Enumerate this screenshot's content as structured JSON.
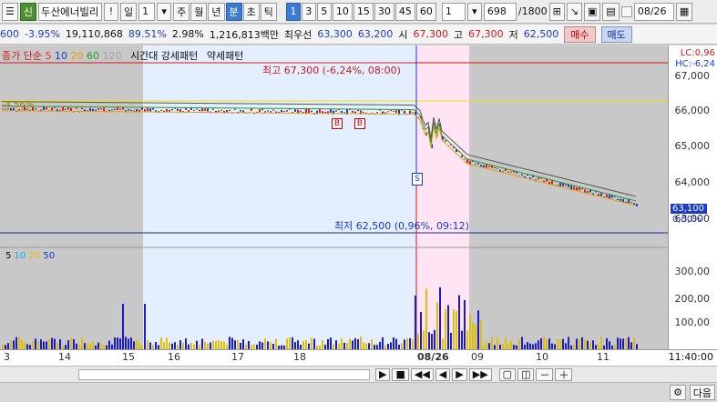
{
  "toolbar": {
    "stock_badge": "신",
    "stock_name": "두산에너빌리",
    "alert": "!",
    "period_day": "일",
    "period_count": "1",
    "period_buttons": [
      "주",
      "월",
      "년",
      "분",
      "초",
      "틱"
    ],
    "selected_period": "분",
    "interval_buttons": [
      "1",
      "3",
      "5",
      "10",
      "15",
      "30",
      "45",
      "60"
    ],
    "selected_interval": "1",
    "count_value": "1",
    "bars_current": "698",
    "bars_total": "/1800",
    "date_value": "08/26"
  },
  "quote": {
    "change": "600",
    "rate": "-3.95%",
    "volume": "19,110,868",
    "vol_ratio": "89.51%",
    "turnover": "2.98%",
    "amount": "1,216,813백만",
    "best_ask_label": "최우선",
    "best_ask": "63,300",
    "best_bid": "63,200",
    "open_label": "시",
    "open": "67,300",
    "high_label": "고",
    "high": "67,300",
    "low_label": "저",
    "low": "62,500",
    "buy_label": "매수",
    "sell_label": "매도"
  },
  "indicators": {
    "price_legend_label": "종가 단순",
    "ma_periods": [
      "5",
      "10",
      "20",
      "60",
      "120"
    ],
    "pattern_strong": "시간대 강세패턴",
    "pattern_weak": "약세패턴",
    "volume_ma_periods": [
      "5",
      "10",
      "20",
      "50"
    ]
  },
  "annotations": {
    "high_text": "최고 67,300 (-6,24%, 08:00)",
    "low_text": "최저 62,500 (0,96%, 09:12)",
    "lc_text": "LC:0,96",
    "hc_text": "HC:-6,24",
    "left_pct": "-4.56%",
    "current_price": "63,100",
    "current_pct": "0,00%",
    "signal_b": "B",
    "signal_s": "S"
  },
  "colors": {
    "ma5": "#ff2020",
    "ma10": "#1a3cc8",
    "ma20": "#e8a000",
    "ma60": "#2a9a2a",
    "ma120": "#a0a0a0",
    "session_blue": "#e3efff",
    "session_pink": "#ffe4f4"
  },
  "chart_data": {
    "type": "candlestick",
    "price_axis_ticks": [
      "67,000",
      "66,000",
      "65,000",
      "64,000",
      "63,000"
    ],
    "volume_axis_ticks": [
      "300,00",
      "200,00",
      "100,00"
    ],
    "x_tick_labels": [
      "3",
      "14",
      "15",
      "16",
      "17",
      "18",
      "08/26",
      "09",
      "10",
      "11"
    ],
    "time_label": "11:40:00",
    "high": 67300,
    "low": 62500,
    "last": 63100,
    "segments": [
      {
        "from": 0,
        "to": 0.62,
        "start": 66000,
        "end": 65900
      },
      {
        "from": 0.62,
        "to": 0.7,
        "start": 65900,
        "end": 64500
      },
      {
        "from": 0.7,
        "to": 1.0,
        "start": 64500,
        "end": 63100
      }
    ]
  },
  "bottom": {
    "next_label": "다음"
  }
}
